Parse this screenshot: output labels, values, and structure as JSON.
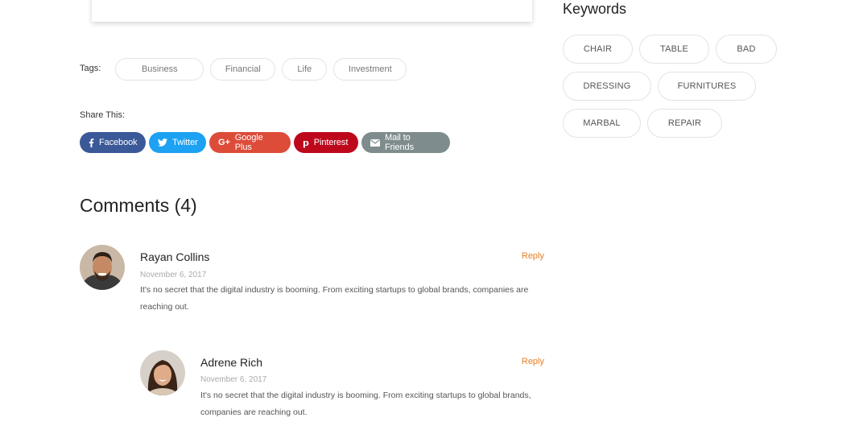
{
  "tags": {
    "label": "Tags:",
    "items": [
      "Business",
      "Financial",
      "Life",
      "Investment"
    ]
  },
  "share": {
    "label": "Share This:",
    "buttons": [
      {
        "label": "Facebook",
        "icon": "facebook-icon",
        "color": "#3b5998"
      },
      {
        "label": "Twitter",
        "icon": "twitter-icon",
        "color": "#1da1f2"
      },
      {
        "label": "Google Plus",
        "icon": "google-plus-icon",
        "color": "#dd4b39"
      },
      {
        "label": "Pinterest",
        "icon": "pinterest-icon",
        "color": "#bd081c"
      },
      {
        "label": "Mail to Friends",
        "icon": "mail-icon",
        "color": "#7f8c8d"
      }
    ]
  },
  "comments": {
    "title": "Comments (4)",
    "items": [
      {
        "name": "Rayan Collins",
        "date": "November 6, 2017",
        "text": "It's no secret that the digital industry is booming. From exciting startups to global brands, companies are reaching out.",
        "reply": "Reply"
      },
      {
        "name": "Adrene Rich",
        "date": "November 6, 2017",
        "text": "It's no secret that the digital industry is booming. From exciting startups to global brands, companies are reaching out.",
        "reply": "Reply"
      }
    ]
  },
  "keywords": {
    "title": "Keywords",
    "rows": [
      [
        "CHAIR",
        "TABLE",
        "BAD"
      ],
      [
        "DRESSING",
        "FURNITURES"
      ],
      [
        "MARBAL",
        "REPAIR"
      ]
    ]
  },
  "colors": {
    "accent": "#e67e22"
  }
}
